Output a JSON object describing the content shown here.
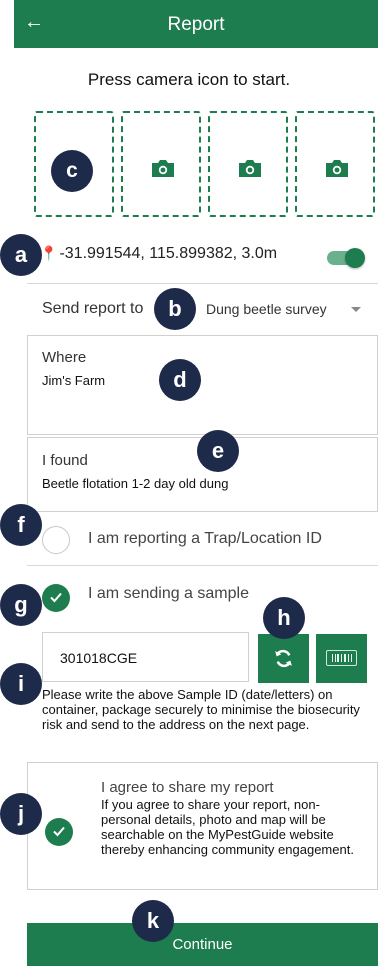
{
  "header": {
    "back_icon": "←",
    "title": "Report"
  },
  "instruction": "Press camera icon to start.",
  "photo_slots": {
    "count": 4,
    "icon": "camera-icon"
  },
  "location": {
    "pin_icon": "map-marker-icon",
    "text": "-31.991544, 115.899382, 3.0m",
    "toggle_on": true
  },
  "send_report": {
    "label": "Send report to",
    "selected": "Dung beetle survey"
  },
  "where": {
    "label": "Where",
    "value": "Jim's Farm"
  },
  "found": {
    "label": "I found",
    "value": "Beetle flotation 1-2 day old dung"
  },
  "trap": {
    "label": "I am reporting a Trap/Location ID",
    "checked": false
  },
  "sample": {
    "label": "I am sending a sample",
    "checked": true,
    "id_value": "301018CGE",
    "barcode_text": "[III|]",
    "note": "Please write the above Sample ID (date/letters) on container, package securely to minimise the biosecurity risk and send to the address on the next page."
  },
  "agree": {
    "title": "I agree to share my report",
    "text": "If you agree to share your report, non-personal details, photo and map will be searchable on the MyPestGuide website thereby enhancing community engagement.",
    "checked": true
  },
  "continue_label": "Continue",
  "markers": {
    "a": "a",
    "b": "b",
    "c": "c",
    "d": "d",
    "e": "e",
    "f": "f",
    "g": "g",
    "h": "h",
    "i": "i",
    "j": "j",
    "k": "k"
  },
  "colors": {
    "primary": "#1e7d4e",
    "marker": "#1e2a4a",
    "toggle_track": "#6bb08c"
  }
}
